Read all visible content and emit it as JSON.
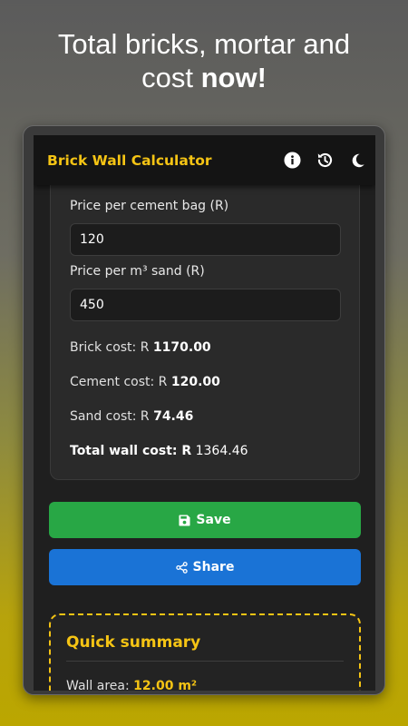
{
  "promo": {
    "line1": "Total bricks, mortar and",
    "line2_plain": "cost ",
    "line2_bold": "now!"
  },
  "appbar": {
    "title": "Brick Wall Calculator",
    "icons": [
      "info-icon",
      "history-icon",
      "moon-icon"
    ]
  },
  "form": {
    "cement_price_label": "Price per cement bag (R)",
    "cement_price_value": "120",
    "sand_price_label": "Price per m³ sand (R)",
    "sand_price_value": "450"
  },
  "costs": {
    "brick_label": "Brick cost: R ",
    "brick_value": "1170.00",
    "cement_label": "Cement cost: R ",
    "cement_value": "120.00",
    "sand_label": "Sand cost: R ",
    "sand_value": "74.46",
    "total_label": "Total wall cost: R",
    "total_value": " 1364.46"
  },
  "actions": {
    "save_label": "Save",
    "share_label": "Share"
  },
  "summary": {
    "title": "Quick summary",
    "wall_label": "Wall area: ",
    "wall_value": "12.00 m²"
  },
  "colors": {
    "accent": "#f5c414",
    "save": "#28a745",
    "share": "#1a73d6"
  }
}
